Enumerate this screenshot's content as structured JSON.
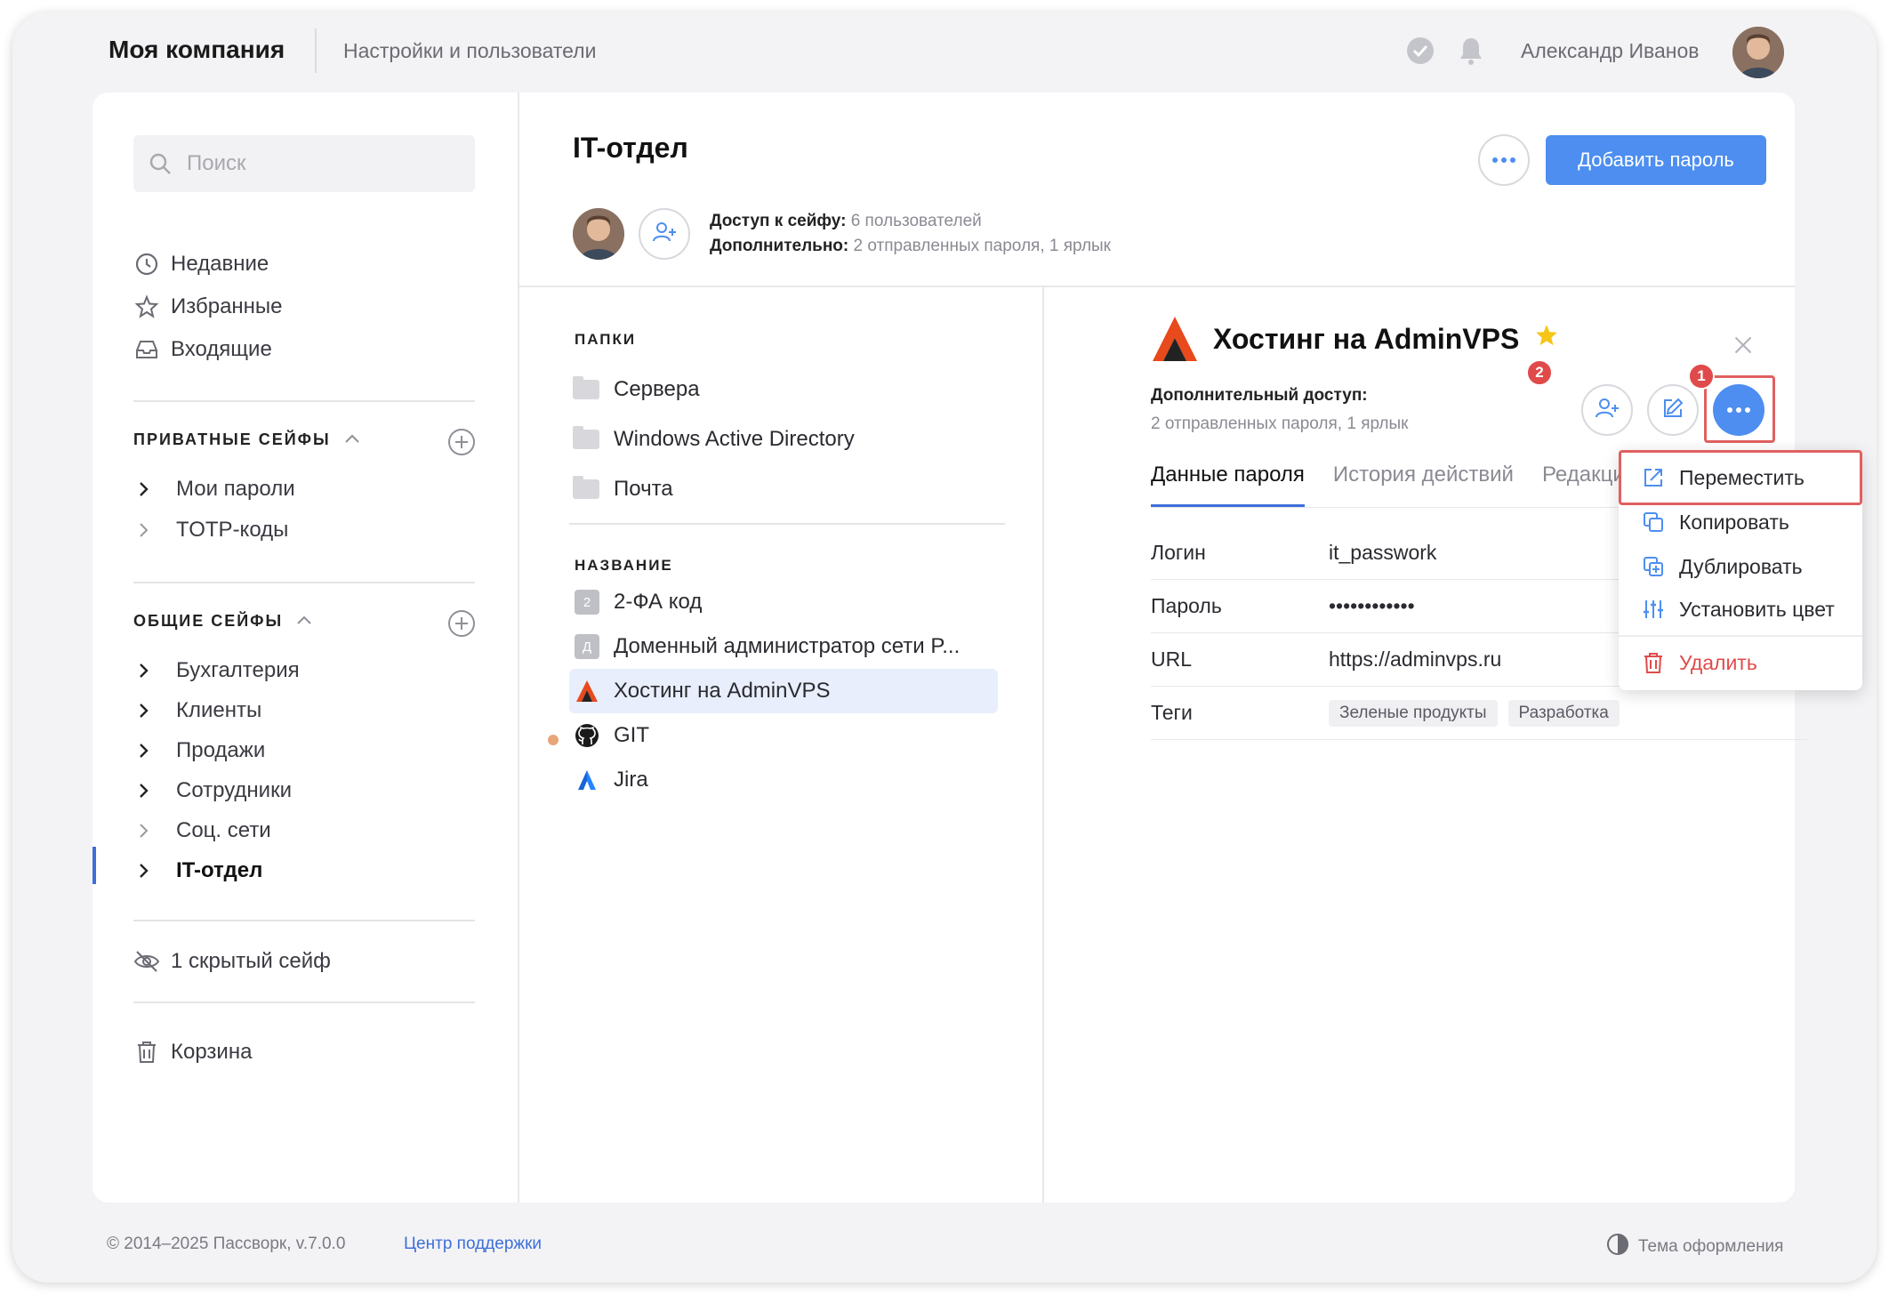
{
  "header": {
    "brand": "Моя компания",
    "breadcrumb": "Настройки и пользователи",
    "user_name": "Александр Иванов"
  },
  "sidebar": {
    "search_placeholder": "Поиск",
    "nav": [
      {
        "label": "Недавние",
        "icon": "clock-icon"
      },
      {
        "label": "Избранные",
        "icon": "star-icon"
      },
      {
        "label": "Входящие",
        "icon": "inbox-icon"
      }
    ],
    "private_title": "ПРИВАТНЫЕ СЕЙФЫ",
    "private_items": [
      "Мои пароли",
      "TOTP-коды"
    ],
    "shared_title": "ОБЩИЕ СЕЙФЫ",
    "shared_items": [
      "Бухгалтерия",
      "Клиенты",
      "Продажи",
      "Сотрудники",
      "Соц. сети",
      "IT-отдел"
    ],
    "active_item": "IT-отдел",
    "hidden_vaults": "1 скрытый сейф",
    "trash": "Корзина"
  },
  "vault": {
    "title": "IT-отдел",
    "access_label": "Доступ к сейфу:",
    "access_value": "6 пользователей",
    "extra_label": "Дополнительно:",
    "extra_value": "2 отправленных пароля, 1 ярлык",
    "add_button": "Добавить пароль"
  },
  "list": {
    "folders_title": "ПАПКИ",
    "folders": [
      "Сервера",
      "Windows Active Directory",
      "Почта"
    ],
    "names_title": "НАЗВАНИЕ",
    "items": [
      {
        "label": "2-ФА код",
        "badge": "2"
      },
      {
        "label": "Доменный администратор сети P...",
        "badge": "Д"
      },
      {
        "label": "Хостинг на AdminVPS",
        "icon": "adminvps-logo-icon"
      },
      {
        "label": "GIT",
        "icon": "github-icon"
      },
      {
        "label": "Jira",
        "icon": "jira-icon"
      }
    ]
  },
  "detail": {
    "title": "Хостинг на AdminVPS",
    "extra_access_label": "Дополнительный доступ:",
    "extra_access_value": "2 отправленных пароля, 1 ярлык",
    "tabs": [
      "Данные пароля",
      "История действий",
      "Редакции"
    ],
    "fields": [
      {
        "label": "Логин",
        "value": "it_passwork"
      },
      {
        "label": "Пароль",
        "value": "••••••••••••"
      },
      {
        "label": "URL",
        "value": "https://adminvps.ru"
      }
    ],
    "tags_label": "Теги",
    "tags": [
      "Зеленые продукты",
      "Разработка"
    ],
    "badge1": "1",
    "badge2": "2"
  },
  "menu": {
    "items": [
      "Переместить",
      "Копировать",
      "Дублировать",
      "Установить цвет"
    ],
    "delete": "Удалить"
  },
  "footer": {
    "copyright": "© 2014–2025 Пассворк, v.7.0.0",
    "support": "Центр поддержки",
    "theme": "Тема оформления"
  },
  "colors": {
    "accent": "#4d8ef0",
    "danger": "#e04a4a",
    "selected_bg": "#e8eefb"
  }
}
